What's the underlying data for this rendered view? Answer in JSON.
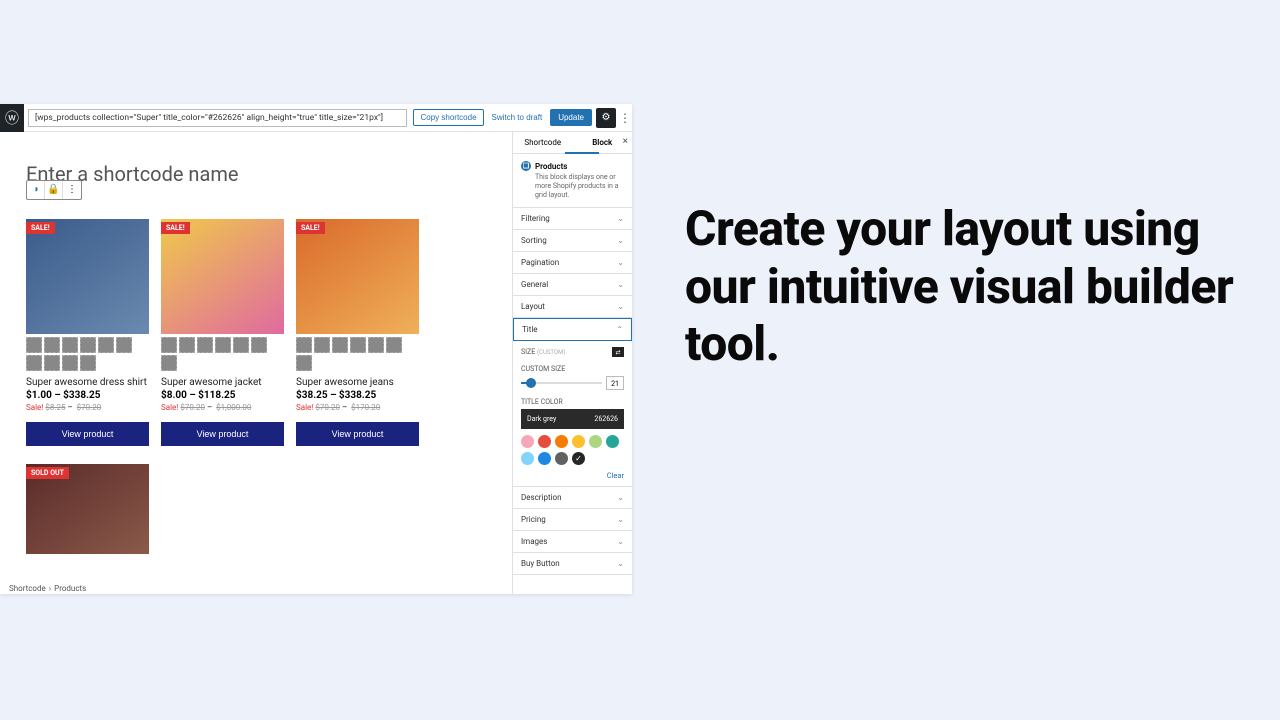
{
  "headline": "Create your layout using our intuitive visual builder tool.",
  "topbar": {
    "shortcode": "[wps_products collection=\"Super\" title_color=\"#262626\" align_height=\"true\" title_size=\"21px\"]",
    "copy": "Copy shortcode",
    "draft": "Switch to draft",
    "update": "Update"
  },
  "canvas": {
    "placeholder": "Enter a shortcode name",
    "view_label": "View product",
    "products": [
      {
        "badge": "SALE!",
        "title": "Super awesome dress shirt",
        "price": "$1.00 – $338.25",
        "sale_label": "Sale!",
        "sale_from": "$8.25",
        "sale_to": "$70.20"
      },
      {
        "badge": "SALE!",
        "title": "Super awesome jacket",
        "price": "$8.00 – $118.25",
        "sale_label": "Sale!",
        "sale_from": "$70.20",
        "sale_to": "$1,000.00"
      },
      {
        "badge": "SALE!",
        "title": "Super awesome jeans",
        "price": "$38.25 – $338.25",
        "sale_label": "Sale!",
        "sale_from": "$70.20",
        "sale_to": "$170.20"
      },
      {
        "badge": "SOLD OUT"
      }
    ]
  },
  "breadcrumb": [
    "Shortcode",
    "Products"
  ],
  "sidebar": {
    "tabs": [
      "Shortcode",
      "Block"
    ],
    "block_name": "Products",
    "block_desc": "This block displays one or more Shopify products in a grid layout.",
    "panels": [
      "Filtering",
      "Sorting",
      "Pagination",
      "General",
      "Layout",
      "Title",
      "Description",
      "Pricing",
      "Images",
      "Buy Button"
    ],
    "title_panel": {
      "size_label": "SIZE",
      "size_state": "(CUSTOM)",
      "custom_size_label": "CUSTOM SIZE",
      "size_value": "21",
      "color_label": "TITLE COLOR",
      "color_name": "Dark grey",
      "color_hex": "262626",
      "swatches": [
        "#f7a8b8",
        "#e84c3d",
        "#f57c00",
        "#fbc02d",
        "#aed581",
        "#26a69a",
        "#81d4fa",
        "#1e88e5",
        "#616161",
        "#262626"
      ],
      "clear": "Clear"
    }
  }
}
